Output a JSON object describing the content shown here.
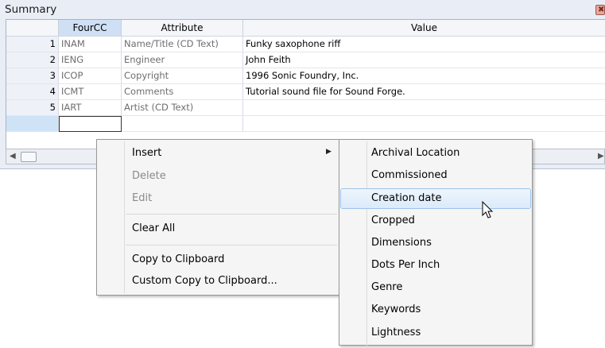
{
  "panel": {
    "title": "Summary",
    "close_glyph": "✖"
  },
  "table": {
    "columns": [
      "FourCC",
      "Attribute",
      "Value"
    ],
    "rows": [
      {
        "num": "1",
        "fourcc": "INAM",
        "attribute": "Name/Title (CD Text)",
        "value": "Funky saxophone riff"
      },
      {
        "num": "2",
        "fourcc": "IENG",
        "attribute": "Engineer",
        "value": "John Feith"
      },
      {
        "num": "3",
        "fourcc": "ICOP",
        "attribute": "Copyright",
        "value": "1996 Sonic Foundry, Inc."
      },
      {
        "num": "4",
        "fourcc": "ICMT",
        "attribute": "Comments",
        "value": "Tutorial sound file for Sound Forge."
      },
      {
        "num": "5",
        "fourcc": "IART",
        "attribute": "Artist (CD Text)",
        "value": ""
      }
    ]
  },
  "scrollbar": {
    "left_glyph": "◀",
    "right_glyph": "▶"
  },
  "context_menu": {
    "insert": "Insert",
    "delete": "Delete",
    "edit": "Edit",
    "clear_all": "Clear All",
    "copy": "Copy to Clipboard",
    "custom_copy": "Custom Copy to Clipboard...",
    "submenu_arrow": "▶"
  },
  "submenu": {
    "items": [
      "Archival Location",
      "Commissioned",
      "Creation date",
      "Cropped",
      "Dimensions",
      "Dots Per Inch",
      "Genre",
      "Keywords",
      "Lightness"
    ],
    "highlighted": "Creation date"
  },
  "colors": {
    "panel_bg": "#e9eef6",
    "menu_bg": "#f5f5f5",
    "highlight_border": "#9fc4ea"
  }
}
